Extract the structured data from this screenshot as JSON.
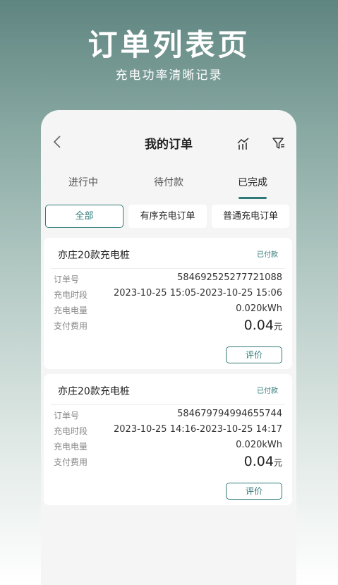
{
  "promo": {
    "title": "订单列表页",
    "subtitle": "充电功率清晰记录"
  },
  "nav": {
    "back_icon": "chevron-left-icon",
    "title": "我的订单",
    "stats_icon": "chart-icon",
    "filter_icon": "filter-icon"
  },
  "tabs": [
    {
      "label": "进行中",
      "active": false
    },
    {
      "label": "待付款",
      "active": false
    },
    {
      "label": "已完成",
      "active": true
    }
  ],
  "chips": [
    {
      "label": "全部",
      "active": true
    },
    {
      "label": "有序充电订单",
      "active": false
    },
    {
      "label": "普通充电订单",
      "active": false
    }
  ],
  "labels": {
    "order_no": "订单号",
    "period": "充电时段",
    "energy": "充电电量",
    "fee": "支付费用",
    "rate_button": "评价",
    "currency_unit": "元"
  },
  "orders": [
    {
      "station": "亦庄20款充电桩",
      "status": "已付款",
      "order_no": "584692525277721088",
      "period": "2023-10-25 15:05-2023-10-25 15:06",
      "energy": "0.020kWh",
      "fee": "0.04"
    },
    {
      "station": "亦庄20款充电桩",
      "status": "已付款",
      "order_no": "584679794994655744",
      "period": "2023-10-25 14:16-2023-10-25 14:17",
      "energy": "0.020kWh",
      "fee": "0.04"
    }
  ],
  "colors": {
    "accent": "#2f7a78",
    "background_top": "#5f8580",
    "card": "#ffffff"
  }
}
